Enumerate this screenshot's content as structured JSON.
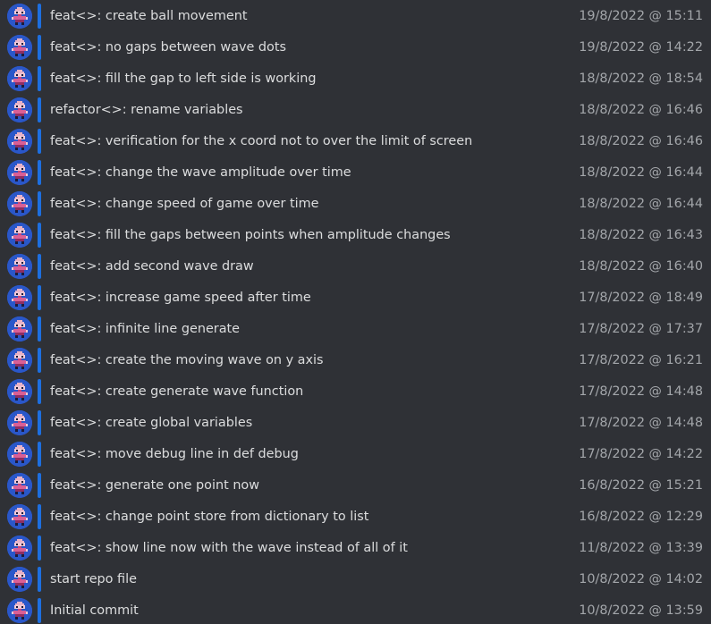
{
  "commits": [
    {
      "message": "feat<>: create ball movement",
      "timestamp": "19/8/2022 @ 15:11"
    },
    {
      "message": "feat<>: no gaps between wave dots",
      "timestamp": "19/8/2022 @ 14:22"
    },
    {
      "message": "feat<>: fill the gap to left side is working",
      "timestamp": "18/8/2022 @ 18:54"
    },
    {
      "message": "refactor<>: rename variables",
      "timestamp": "18/8/2022 @ 16:46"
    },
    {
      "message": "feat<>: verification for the x coord not to over the limit of screen",
      "timestamp": "18/8/2022 @ 16:46"
    },
    {
      "message": "feat<>: change the wave amplitude over time",
      "timestamp": "18/8/2022 @ 16:44"
    },
    {
      "message": "feat<>: change speed of game over time",
      "timestamp": "18/8/2022 @ 16:44"
    },
    {
      "message": "feat<>: fill the gaps between points when amplitude changes",
      "timestamp": "18/8/2022 @ 16:43"
    },
    {
      "message": "feat<>: add second wave draw",
      "timestamp": "18/8/2022 @ 16:40"
    },
    {
      "message": "feat<>: increase game speed after time",
      "timestamp": "17/8/2022 @ 18:49"
    },
    {
      "message": "feat<>: infinite line generate",
      "timestamp": "17/8/2022 @ 17:37"
    },
    {
      "message": "feat<>: create the moving wave on y axis",
      "timestamp": "17/8/2022 @ 16:21"
    },
    {
      "message": "feat<>: create generate wave function",
      "timestamp": "17/8/2022 @ 14:48"
    },
    {
      "message": "feat<>: create global variables",
      "timestamp": "17/8/2022 @ 14:48"
    },
    {
      "message": "feat<>: move debug line in def debug",
      "timestamp": "17/8/2022 @ 14:22"
    },
    {
      "message": "feat<>: generate one point now",
      "timestamp": "16/8/2022 @ 15:21"
    },
    {
      "message": "feat<>: change point store from dictionary to list",
      "timestamp": "16/8/2022 @ 12:29"
    },
    {
      "message": "feat<>: show line now with the wave instead of all of it",
      "timestamp": "11/8/2022 @ 13:39"
    },
    {
      "message": "start repo file",
      "timestamp": "10/8/2022 @ 14:02"
    },
    {
      "message": "Initial commit",
      "timestamp": "10/8/2022 @ 13:59"
    }
  ],
  "colors": {
    "background": "#2f3136",
    "avatar_background": "#2a57c9",
    "accent_bar": "#1d6fe0",
    "message_text": "#dcddde",
    "timestamp_text": "#a3a6aa"
  },
  "icons": {
    "avatar": "pixel-character-avatar-icon"
  }
}
